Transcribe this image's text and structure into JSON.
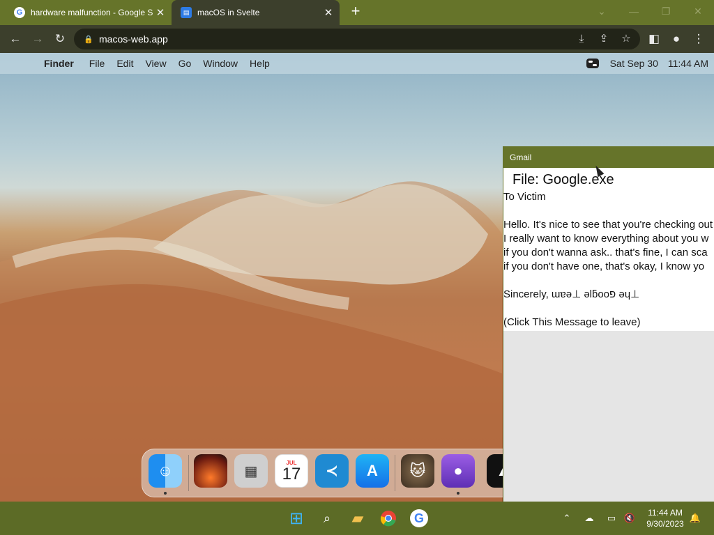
{
  "browser": {
    "tabs": [
      {
        "title": "hardware malfunction - Google S",
        "icon": "google-icon",
        "active": false
      },
      {
        "title": "macOS in Svelte",
        "icon": "macos-app-icon",
        "active": true
      }
    ],
    "url": "macos-web.app"
  },
  "menubar": {
    "app_name": "Finder",
    "menus": [
      "File",
      "Edit",
      "View",
      "Go",
      "Window",
      "Help"
    ],
    "date": "Sat Sep 30",
    "time": "11:44 AM"
  },
  "dock": {
    "apps": [
      {
        "name": "Finder",
        "icon": "finder-icon",
        "running": true
      },
      {
        "name": "Wallpapers",
        "icon": "wallpaper-icon",
        "running": false
      },
      {
        "name": "Calculator",
        "icon": "calculator-icon",
        "running": false
      },
      {
        "name": "Calendar",
        "icon": "calendar-icon",
        "running": false,
        "month": "JUL",
        "day": "17"
      },
      {
        "name": "VS Code",
        "icon": "vscode-icon",
        "running": false
      },
      {
        "name": "App Store",
        "icon": "app-store-icon",
        "running": false
      },
      {
        "name": "Cat",
        "icon": "cat-icon",
        "running": false
      },
      {
        "name": "GitHub",
        "icon": "github-icon",
        "running": true
      },
      {
        "name": "App",
        "icon": "app-icon",
        "running": false
      }
    ]
  },
  "gmail": {
    "title": "Gmail",
    "file_line": "File: Google.exe",
    "lines": [
      "To Victim",
      "",
      "Hello. It's nice to see that you're checking out",
      "I really want to know everything about you w",
      "if you don't wanna ask.. that's fine, I can sca",
      "if you don't have one, that's okay, I know yo",
      "",
      "Sincerely, ɯɐǝ⊥ ǝlƃooפ ǝɥ⊥",
      "",
      "(Click This Message to leave)"
    ]
  },
  "taskbar": {
    "time": "11:44 AM",
    "date": "9/30/2023"
  },
  "colors": {
    "tabstrip": "#66742a",
    "toolbar": "#3c3f2c",
    "taskbar": "#5c6b26"
  }
}
